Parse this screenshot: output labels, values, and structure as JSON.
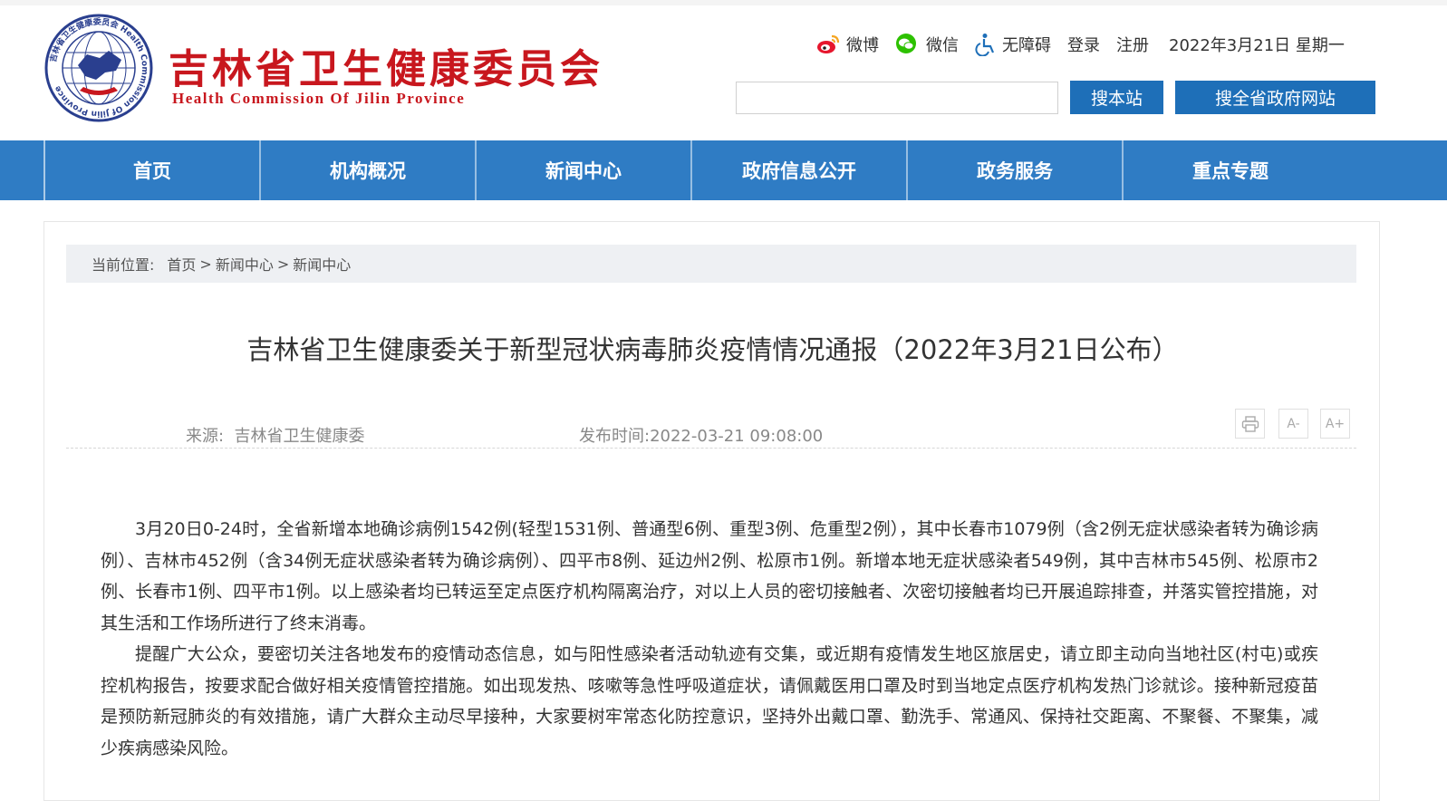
{
  "header": {
    "logo_cn": "吉林省卫生健康委员会",
    "logo_en": "Health Commission Of Jilin Province",
    "emblem_ring_text": "吉林省卫生健康委员会 Health Commission Of Jilin Province",
    "top_links": {
      "weibo": "微博",
      "wechat": "微信",
      "accessibility": "无障碍",
      "login": "登录",
      "register": "注册",
      "date": "2022年3月21日 星期一"
    },
    "search": {
      "placeholder": "",
      "btn_site": "搜本站",
      "btn_province": "搜全省政府网站"
    },
    "colors": {
      "brand_red": "#c8171e",
      "nav_blue": "#2f7cc4",
      "button_blue": "#1e6fb8"
    }
  },
  "nav": {
    "items": [
      "首页",
      "机构概况",
      "新闻中心",
      "政府信息公开",
      "政务服务",
      "重点专题"
    ]
  },
  "breadcrumb": {
    "prefix": "当前位置:",
    "items": [
      "首页",
      "新闻中心",
      "新闻中心"
    ],
    "separator": ">"
  },
  "article": {
    "title": "吉林省卫生健康委关于新型冠状病毒肺炎疫情情况通报（2022年3月21日公布）",
    "source_label": "来源:",
    "source": "吉林省卫生健康委",
    "time_label": "发布时间:",
    "time": "2022-03-21 09:08:00",
    "tools": {
      "print_icon": "print-icon",
      "font_minus": "A-",
      "font_plus": "A+"
    },
    "paragraphs": [
      "3月20日0-24时，全省新增本地确诊病例1542例(轻型1531例、普通型6例、重型3例、危重型2例），其中长春市1079例（含2例无症状感染者转为确诊病例）、吉林市452例（含34例无症状感染者转为确诊病例）、四平市8例、延边州2例、松原市1例。新增本地无症状感染者549例，其中吉林市545例、松原市2例、长春市1例、四平市1例。以上感染者均已转运至定点医疗机构隔离治疗，对以上人员的密切接触者、次密切接触者均已开展追踪排查，并落实管控措施，对其生活和工作场所进行了终末消毒。",
      "提醒广大公众，要密切关注各地发布的疫情动态信息，如与阳性感染者活动轨迹有交集，或近期有疫情发生地区旅居史，请立即主动向当地社区(村屯)或疾控机构报告，按要求配合做好相关疫情管控措施。如出现发热、咳嗽等急性呼吸道症状，请佩戴医用口罩及时到当地定点医疗机构发热门诊就诊。接种新冠疫苗是预防新冠肺炎的有效措施，请广大群众主动尽早接种，大家要树牢常态化防控意识，坚持外出戴口罩、勤洗手、常通风、保持社交距离、不聚餐、不聚集，减少疾病感染风险。"
    ]
  }
}
